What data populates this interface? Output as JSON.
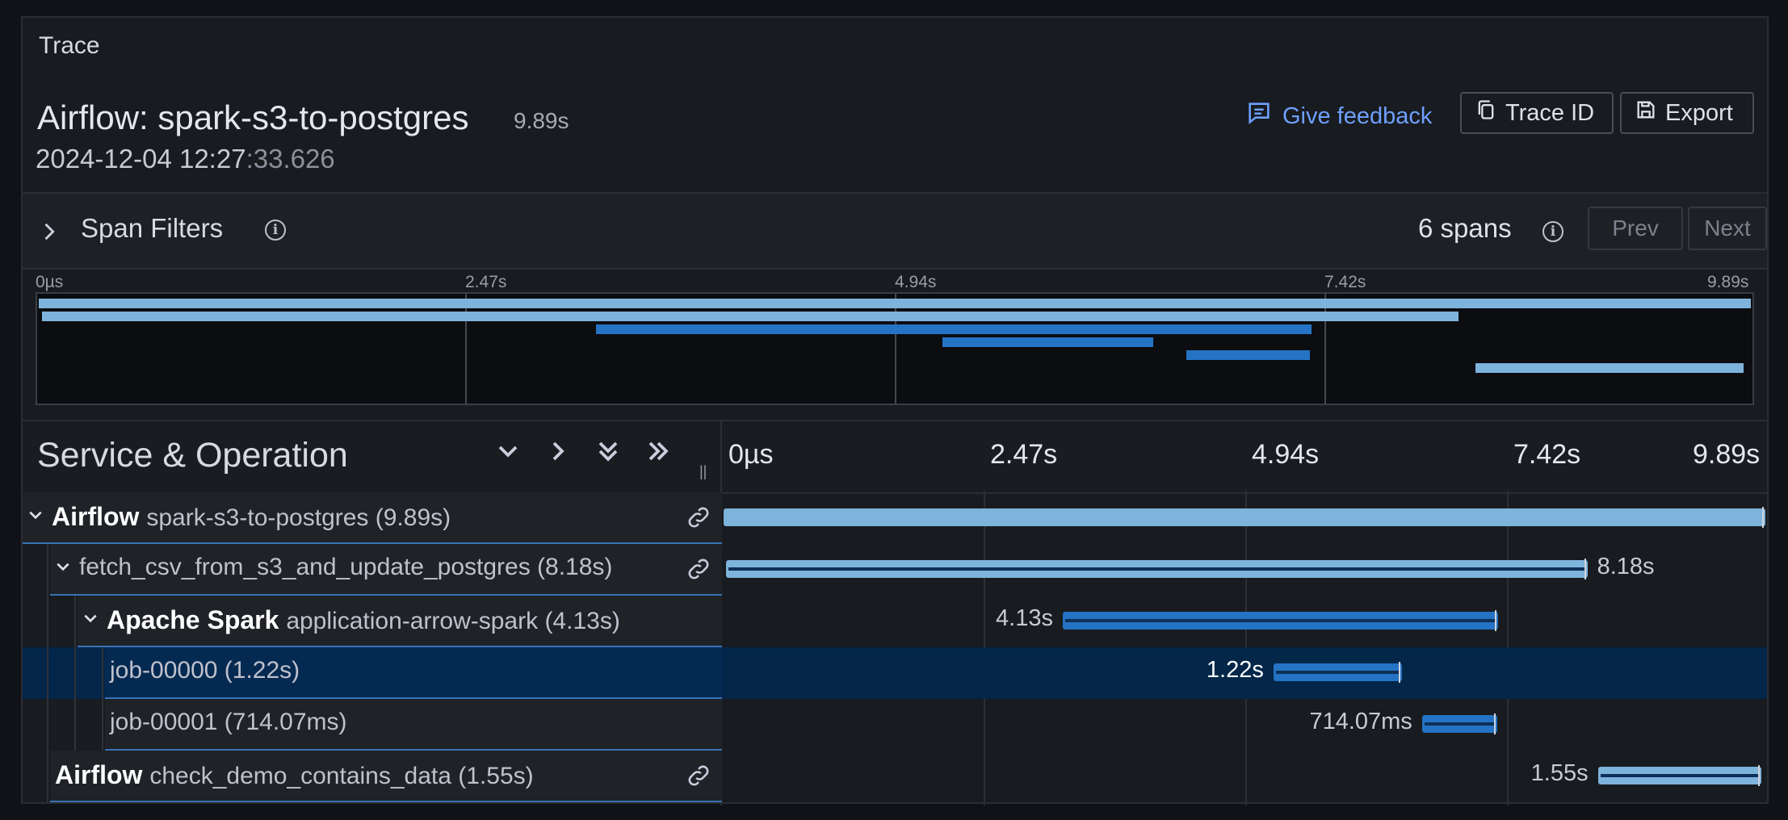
{
  "panel": {
    "title": "Trace"
  },
  "trace": {
    "name": "Airflow: spark-s3-to-postgres",
    "duration": "9.89s",
    "date_main": "2024-12-04 12:27",
    "date_dim": ":33.626"
  },
  "actions": {
    "feedback": "Give feedback",
    "trace_id": "Trace ID",
    "export": "Export"
  },
  "filters": {
    "label": "Span Filters",
    "spans_count": "6 spans",
    "prev": "Prev",
    "next": "Next"
  },
  "minimap": {
    "ticks": [
      "0µs",
      "2.47s",
      "4.94s",
      "7.42s",
      "9.89s"
    ]
  },
  "header": {
    "title": "Service & Operation",
    "ticks": [
      "0µs",
      "2.47s",
      "4.94s",
      "7.42s",
      "9.89s"
    ]
  },
  "total_duration_s": 9.89,
  "spans": [
    {
      "service": "Airflow",
      "operation": "spark-s3-to-postgres (9.89s)",
      "label": "",
      "start": 0.0,
      "duration": 9.89,
      "color": "#7eb3dc",
      "depth": 0,
      "expanded": true,
      "link": true
    },
    {
      "service": "",
      "operation": "fetch_csv_from_s3_and_update_postgres (8.18s)",
      "label": "8.18s",
      "start": 0.02,
      "duration": 8.18,
      "color": "#7eb3dc",
      "depth": 1,
      "expanded": true,
      "link": true
    },
    {
      "service": "Apache Spark",
      "operation": "application-arrow-spark (4.13s)",
      "label": "4.13s",
      "start": 3.22,
      "duration": 4.13,
      "color": "#2473c4",
      "depth": 2,
      "expanded": true,
      "link": false
    },
    {
      "service": "",
      "operation": "job-00000 (1.22s)",
      "label": "1.22s",
      "start": 5.22,
      "duration": 1.22,
      "color": "#2473c4",
      "depth": 3,
      "expanded": false,
      "link": false,
      "selected": true
    },
    {
      "service": "",
      "operation": "job-00001 (714.07ms)",
      "label": "714.07ms",
      "start": 6.63,
      "duration": 0.714,
      "color": "#2473c4",
      "depth": 3,
      "expanded": false,
      "link": false
    },
    {
      "service": "Airflow",
      "operation": "check_demo_contains_data (1.55s)",
      "label": "1.55s",
      "start": 8.3,
      "duration": 1.55,
      "color": "#7eb3dc",
      "depth": 1,
      "expanded": false,
      "link": true
    }
  ]
}
